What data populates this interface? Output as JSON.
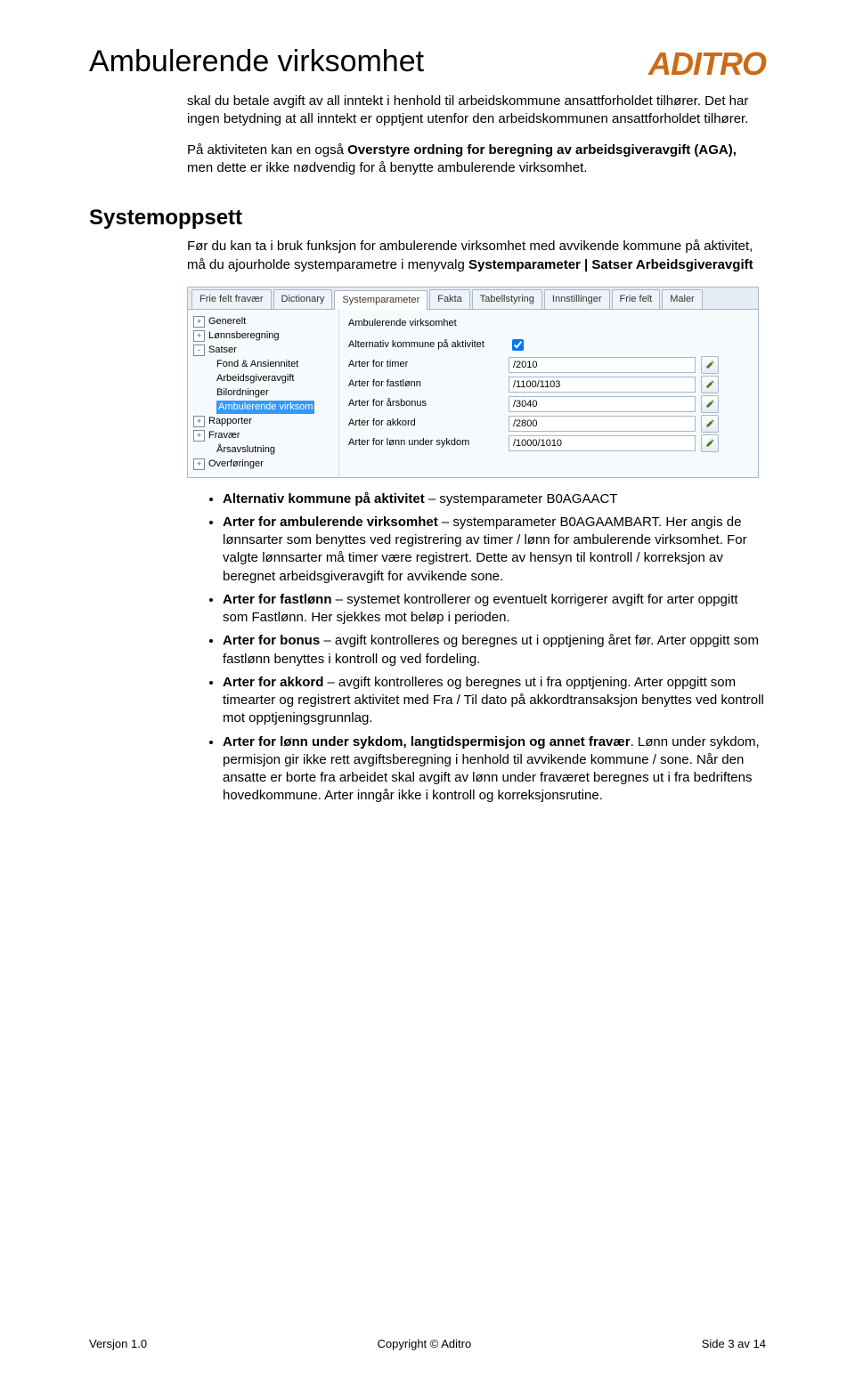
{
  "header": {
    "title": "Ambulerende virksomhet",
    "logo_text": "ADITRO"
  },
  "intro": {
    "p1": "skal du betale avgift av all inntekt i henhold til arbeidskommune ansattforholdet tilhører. Det har ingen betydning at all inntekt er opptjent utenfor den arbeidskommunen ansattforholdet tilhører.",
    "p2_pre": "På aktiviteten kan en også ",
    "p2_bold": "Overstyre ordning for beregning av arbeidsgiveravgift (AGA),",
    "p2_post": " men dette er ikke nødvendig for å benytte ambulerende virksomhet."
  },
  "section": {
    "heading": "Systemoppsett",
    "lead_pre": "Før du kan ta i bruk funksjon for ambulerende virksomhet med avvikende kommune på aktivitet, må du ajourholde systemparametre i menyvalg ",
    "lead_bold": "Systemparameter | Satser Arbeidsgiveravgift"
  },
  "screenshot": {
    "tabs": [
      "Frie felt fravær",
      "Dictionary",
      "Systemparameter",
      "Fakta",
      "Tabellstyring",
      "Innstillinger",
      "Frie felt",
      "Maler"
    ],
    "active_tab_index": 2,
    "tree": [
      {
        "icon": "+",
        "label": "Generelt",
        "indent": 0
      },
      {
        "icon": "+",
        "label": "Lønnsberegning",
        "indent": 0
      },
      {
        "icon": "-",
        "label": "Satser",
        "indent": 0
      },
      {
        "icon": "",
        "label": "Fond & Ansiennitet",
        "indent": 1
      },
      {
        "icon": "",
        "label": "Arbeidsgiveravgift",
        "indent": 1
      },
      {
        "icon": "",
        "label": "Bilordninger",
        "indent": 1
      },
      {
        "icon": "",
        "label": "Ambulerende virksom",
        "indent": 1,
        "selected": true
      },
      {
        "icon": "+",
        "label": "Rapporter",
        "indent": 0
      },
      {
        "icon": "+",
        "label": "Fravær",
        "indent": 0
      },
      {
        "icon": "",
        "label": "Årsavslutning",
        "indent": 1
      },
      {
        "icon": "+",
        "label": "Overføringer",
        "indent": 0
      }
    ],
    "form_title": "Ambulerende virksomhet",
    "rows": [
      {
        "label": "Alternativ kommune på aktivitet",
        "type": "checkbox",
        "value": "true"
      },
      {
        "label": "Arter for timer",
        "type": "text",
        "value": "/2010"
      },
      {
        "label": "Arter for fastlønn",
        "type": "text",
        "value": "/1100/1103"
      },
      {
        "label": "Arter for årsbonus",
        "type": "text",
        "value": "/3040"
      },
      {
        "label": "Arter for akkord",
        "type": "text",
        "value": "/2800"
      },
      {
        "label": "Arter for lønn under sykdom",
        "type": "text",
        "value": "/1000/1010"
      }
    ]
  },
  "bullets": [
    {
      "b": "Alternativ kommune på aktivitet",
      "rest": " – systemparameter B0AGAACT"
    },
    {
      "b": "Arter for ambulerende virksomhet",
      "rest": " – systemparameter B0AGAAMBART. Her angis de lønnsarter som benyttes ved registrering av timer / lønn for ambulerende virksomhet. For valgte lønnsarter må timer være registrert. Dette av hensyn til kontroll / korreksjon av beregnet arbeidsgiveravgift for avvikende sone."
    },
    {
      "b": "Arter for fastlønn",
      "rest": " – systemet kontrollerer og eventuelt korrigerer avgift for arter oppgitt som Fastlønn. Her sjekkes mot beløp i perioden."
    },
    {
      "b": "Arter for bonus",
      "rest": " – avgift kontrolleres og beregnes ut i opptjening året før. Arter oppgitt som fastlønn benyttes i kontroll og ved fordeling."
    },
    {
      "b": "Arter for akkord",
      "rest": " – avgift kontrolleres og beregnes ut i fra opptjening. Arter oppgitt som timearter og registrert aktivitet med Fra / Til dato på akkordtransaksjon benyttes ved kontroll mot opptjeningsgrunnlag."
    },
    {
      "b": "Arter for lønn under sykdom, langtidspermisjon og annet fravær",
      "rest": ". Lønn under sykdom, permisjon gir ikke rett avgiftsberegning i henhold til avvikende kommune / sone. Når den ansatte er borte fra arbeidet skal avgift av lønn under fraværet beregnes ut i fra bedriftens hovedkommune. Arter inngår ikke i kontroll og korreksjonsrutine."
    }
  ],
  "footer": {
    "left": "Versjon 1.0",
    "center": "Copyright © Aditro",
    "right": "Side 3 av 14"
  }
}
